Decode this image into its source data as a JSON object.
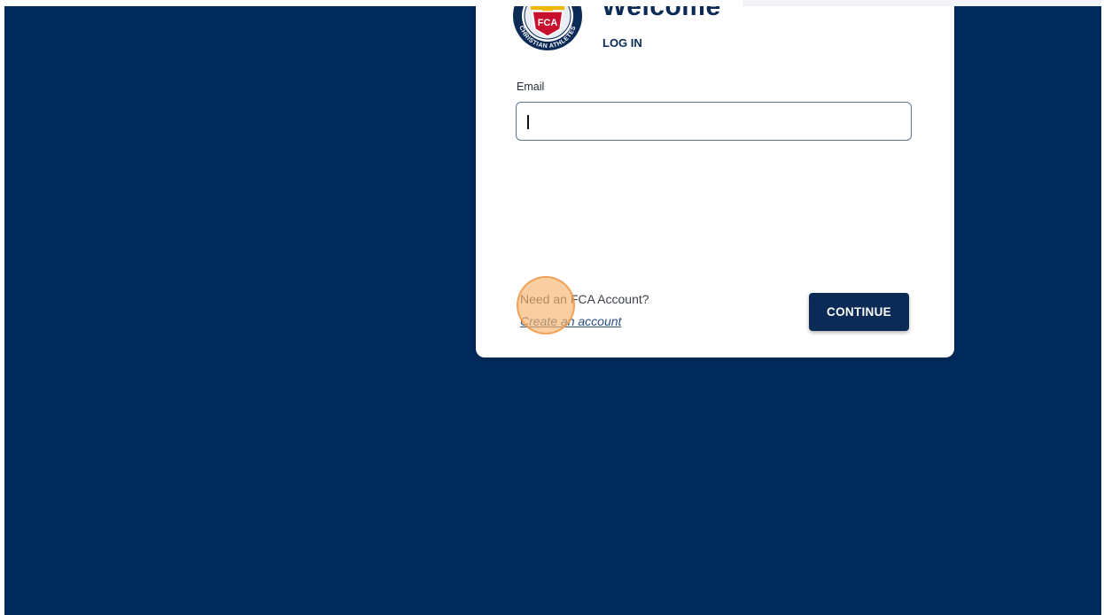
{
  "login": {
    "title": "Welcome",
    "subtitle": "LOG IN",
    "email_label": "Email",
    "email_value": "",
    "email_placeholder": "",
    "need_account_text": "Need an FCA Account?",
    "create_account_link": "Create an account",
    "continue_button": "CONTINUE"
  },
  "logo": {
    "name": "fca-logo",
    "monogram": "FCA",
    "ring_text": "CHRISTIAN ATHLETES"
  },
  "colors": {
    "background": "#002b5c",
    "brand_navy": "#0b2a56",
    "link": "#2c4f82",
    "click_marker": "#f8b46e"
  }
}
